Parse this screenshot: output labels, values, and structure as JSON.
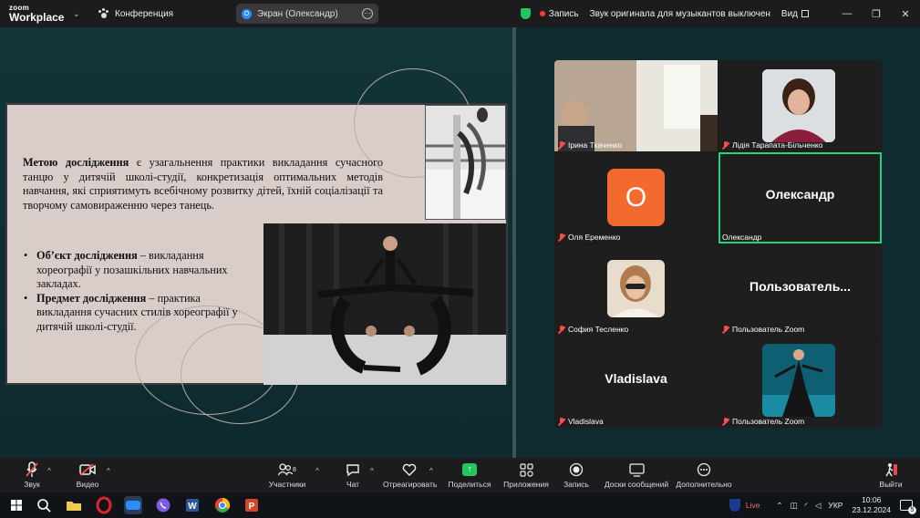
{
  "titlebar": {
    "brand_top": "zoom",
    "brand_bottom": "Workplace",
    "conference": "Конференция",
    "screen_tab": "Экран (Олександр)",
    "screen_tab_icon": "О",
    "recording": "Запись",
    "original_sound": "Звук оригинала для музыкантов выключен",
    "view": "Вид",
    "minimize": "—",
    "maximize": "❐",
    "close": "✕"
  },
  "slide": {
    "para_bold": "Метою дослідження",
    "para_rest": " є узагальнення практики викладання сучасного танцю у дитячій школі-студії, конкретизація оптимальних методів навчання, які сприятимуть всебічному розвитку дітей, їхній соціалізації та творчому самовираженню через танець.",
    "bullets": [
      {
        "bold": "Об’єкт дослідження",
        "rest": " – викладання хореографії у позашкільних навчальних закладах."
      },
      {
        "bold": "Предмет дослідження",
        "rest": " – практика викладання сучасних стилів хореографії у дитячій школі-студії."
      }
    ]
  },
  "gallery": {
    "tiles": [
      {
        "name": "Ірина Ткаченко",
        "big": ""
      },
      {
        "name": "Лідія Тарапата-Більченко",
        "big": ""
      },
      {
        "name": "Оля Еременко",
        "big": "",
        "avatar_letter": "О"
      },
      {
        "name": "Олександр",
        "big": "Олександр"
      },
      {
        "name": "София Тесленко",
        "big": ""
      },
      {
        "name": "Пользователь Zoom",
        "big": "Пользователь..."
      },
      {
        "name": "Vladislava",
        "big": "Vladislava"
      },
      {
        "name": "Пользователь Zoom",
        "big": ""
      }
    ]
  },
  "toolbar": {
    "audio": "Звук",
    "video": "Видео",
    "participants": "Участники",
    "participants_count": "8",
    "chat": "Чат",
    "react": "Отреагировать",
    "share": "Поделиться",
    "apps": "Приложения",
    "record": "Запись",
    "whiteboards": "Доски сообщений",
    "more": "Дополнительно",
    "leave": "Выйти"
  },
  "taskbar": {
    "live": "Live",
    "lang": "УКР",
    "time": "10:06",
    "date": "23.12.2024",
    "notif_count": "5"
  },
  "colors": {
    "active_border": "#23d57a",
    "avatar_orange": "#f26a2e",
    "share_green": "#22c55e",
    "mic_off_red": "#ff4d4d"
  }
}
